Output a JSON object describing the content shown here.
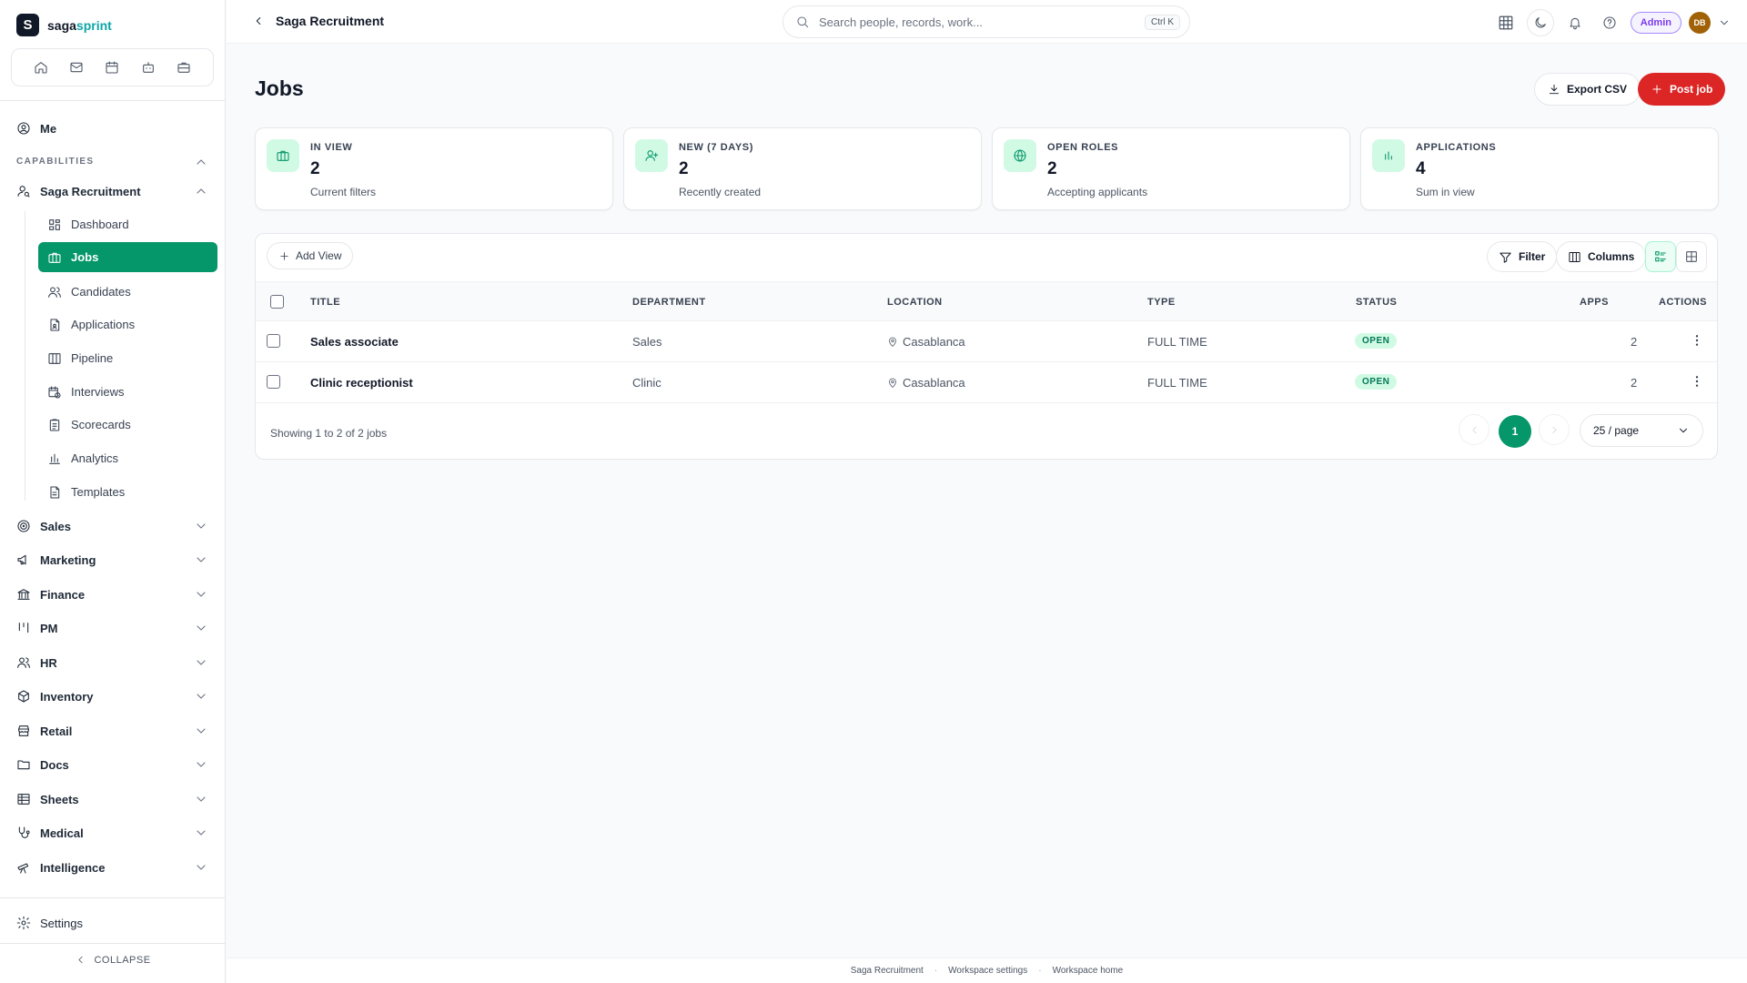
{
  "brand": {
    "logo_letter": "S",
    "name_main": "saga",
    "name_accent": "sprint"
  },
  "sidebar": {
    "me_label": "Me",
    "capabilities_label": "CAPABILITIES",
    "module_label": "Saga Recruitment",
    "sub_items": [
      {
        "label": "Dashboard",
        "icon": "dashboard-icon"
      },
      {
        "label": "Jobs",
        "icon": "briefcase-icon",
        "active": true
      },
      {
        "label": "Candidates",
        "icon": "users-icon"
      },
      {
        "label": "Applications",
        "icon": "file-icon"
      },
      {
        "label": "Pipeline",
        "icon": "columns-icon"
      },
      {
        "label": "Interviews",
        "icon": "calendar-clock-icon"
      },
      {
        "label": "Scorecards",
        "icon": "clipboard-icon"
      },
      {
        "label": "Analytics",
        "icon": "bar-chart-icon"
      },
      {
        "label": "Templates",
        "icon": "file-text-icon"
      }
    ],
    "groups": [
      {
        "label": "Sales",
        "icon": "target-icon"
      },
      {
        "label": "Marketing",
        "icon": "megaphone-icon"
      },
      {
        "label": "Finance",
        "icon": "bank-icon"
      },
      {
        "label": "PM",
        "icon": "kanban-icon"
      },
      {
        "label": "HR",
        "icon": "users-icon"
      },
      {
        "label": "Inventory",
        "icon": "box-icon"
      },
      {
        "label": "Retail",
        "icon": "store-icon"
      },
      {
        "label": "Docs",
        "icon": "folder-icon"
      },
      {
        "label": "Sheets",
        "icon": "table-icon"
      },
      {
        "label": "Medical",
        "icon": "stethoscope-icon"
      },
      {
        "label": "Intelligence",
        "icon": "telescope-icon"
      }
    ],
    "settings_label": "Settings",
    "collapse_label": "COLLAPSE"
  },
  "topbar": {
    "breadcrumb": "Saga Recruitment",
    "search_placeholder": "Search people, records, work...",
    "shortcut": "Ctrl K",
    "role_badge": "Admin",
    "avatar_initials": "DB"
  },
  "page": {
    "title": "Jobs",
    "export_label": "Export CSV",
    "post_label": "Post job"
  },
  "stats": [
    {
      "label": "IN VIEW",
      "value": "2",
      "sub": "Current filters",
      "icon": "briefcase-icon"
    },
    {
      "label": "NEW (7 DAYS)",
      "value": "2",
      "sub": "Recently created",
      "icon": "user-plus-icon"
    },
    {
      "label": "OPEN ROLES",
      "value": "2",
      "sub": "Accepting applicants",
      "icon": "globe-icon"
    },
    {
      "label": "APPLICATIONS",
      "value": "4",
      "sub": "Sum in view",
      "icon": "bar-chart-icon"
    }
  ],
  "table": {
    "add_view_label": "Add View",
    "filter_label": "Filter",
    "columns_label": "Columns",
    "headers": {
      "title": "TITLE",
      "department": "DEPARTMENT",
      "location": "LOCATION",
      "type": "TYPE",
      "status": "STATUS",
      "apps": "APPS",
      "actions": "ACTIONS"
    },
    "rows": [
      {
        "title": "Sales associate",
        "department": "Sales",
        "location": "Casablanca",
        "type": "FULL TIME",
        "status": "OPEN",
        "apps": "2"
      },
      {
        "title": "Clinic receptionist",
        "department": "Clinic",
        "location": "Casablanca",
        "type": "FULL TIME",
        "status": "OPEN",
        "apps": "2"
      }
    ],
    "showing_text": "Showing 1 to 2 of 2 jobs",
    "current_page": "1",
    "per_page": "25 / page"
  },
  "footer": {
    "links": [
      "Saga Recruitment",
      "Workspace settings",
      "Workspace home"
    ]
  },
  "colors": {
    "accent": "#059669",
    "danger": "#dc2626",
    "admin": "#7c3aed"
  }
}
